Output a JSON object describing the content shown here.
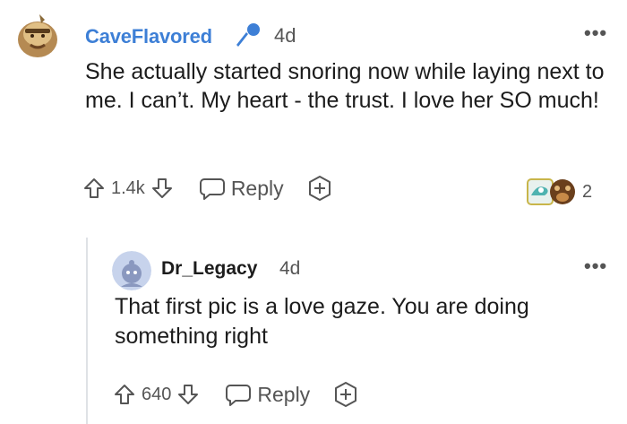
{
  "comment": {
    "username": "CaveFlavored",
    "time": "4d",
    "body": "She actually started snoring now while laying next to me. I can’t. My heart - the trust. I love her SO much!",
    "score": "1.4k",
    "reply_label": "Reply",
    "award_count": "2",
    "more": "•••"
  },
  "reply": {
    "username": "Dr_Legacy",
    "time": "4d",
    "body": "That first pic is a love gaze. You are doing something right",
    "score": "640",
    "reply_label": "Reply",
    "more": "•••"
  },
  "colors": {
    "username_link": "#3d7fd6",
    "icon_gray": "#555555",
    "thread_line": "#dfe2e6"
  },
  "icons": {
    "mic": "microphone-icon",
    "upvote": "arrow-up-icon",
    "downvote": "arrow-down-icon",
    "reply": "speech-bubble-icon",
    "award": "plus-circle-icon",
    "more": "ellipsis-icon"
  }
}
